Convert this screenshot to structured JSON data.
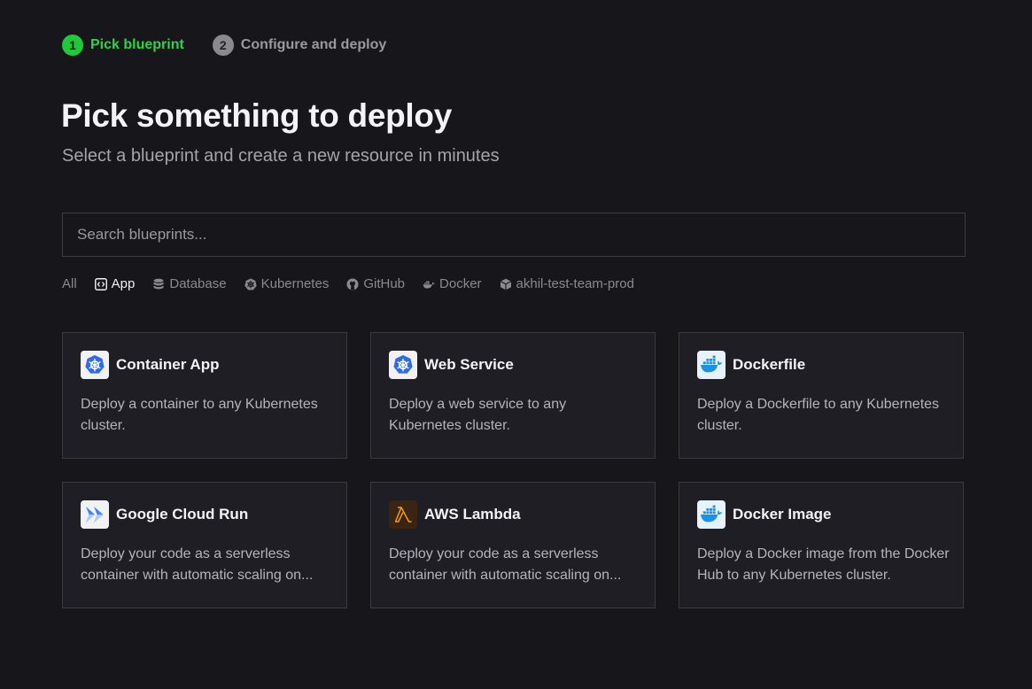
{
  "steps": [
    {
      "number": "1",
      "label": "Pick blueprint",
      "state": "active"
    },
    {
      "number": "2",
      "label": "Configure and deploy",
      "state": "inactive"
    }
  ],
  "header": {
    "title": "Pick something to deploy",
    "subtitle": "Select a blueprint and create a new resource in minutes"
  },
  "search": {
    "placeholder": "Search blueprints...",
    "value": ""
  },
  "filters": [
    {
      "label": "All",
      "icon": "none"
    },
    {
      "label": "App",
      "icon": "code-icon",
      "active": true
    },
    {
      "label": "Database",
      "icon": "database-icon"
    },
    {
      "label": "Kubernetes",
      "icon": "kubernetes-icon"
    },
    {
      "label": "GitHub",
      "icon": "github-icon"
    },
    {
      "label": "Docker",
      "icon": "docker-icon"
    },
    {
      "label": "akhil-test-team-prod",
      "icon": "cube-icon"
    }
  ],
  "blueprints": [
    {
      "title": "Container App",
      "description": "Deploy a container to any Kubernetes cluster.",
      "icon": "kubernetes-icon"
    },
    {
      "title": "Web Service",
      "description": "Deploy a web service to any Kubernetes cluster.",
      "icon": "kubernetes-icon"
    },
    {
      "title": "Dockerfile",
      "description": "Deploy a Dockerfile to any Kubernetes cluster.",
      "icon": "docker-icon"
    },
    {
      "title": "Google Cloud Run",
      "description": "Deploy your code as a serverless container with automatic scaling on...",
      "icon": "google-cloud-run-icon"
    },
    {
      "title": "AWS Lambda",
      "description": "Deploy your code as a serverless container with automatic scaling on...",
      "icon": "aws-lambda-icon"
    },
    {
      "title": "Docker Image",
      "description": "Deploy a Docker image from the Docker Hub to any Kubernetes cluster.",
      "icon": "docker-icon"
    }
  ],
  "colors": {
    "background": "#17161b",
    "card": "#1f1e24",
    "accent_green": "#21c93a",
    "kubernetes_blue": "#326ce5",
    "docker_blue": "#1d91e6",
    "lambda_orange": "#f39a1d"
  }
}
